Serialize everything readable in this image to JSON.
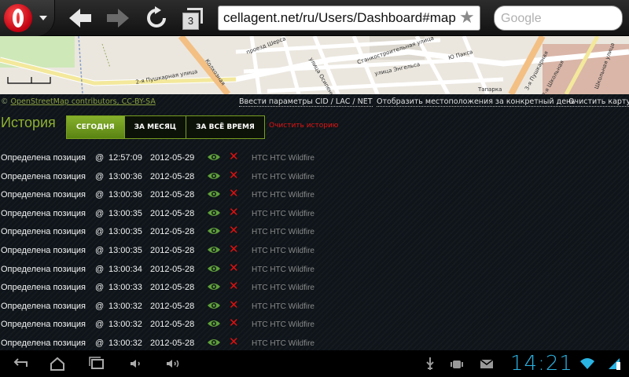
{
  "browser": {
    "tabs_count": "3",
    "url": "cellagent.net/ru/Users/Dashboard#map",
    "search_placeholder": "Google"
  },
  "map": {
    "street_labels": [
      "2-я Пушкарная улица",
      "Колхозная",
      "проезд Шерса",
      "Станкостроительная улица",
      "улица Энгельса",
      "Тапарка",
      "Ю Пакса",
      "улица Осипенко",
      "3-я Пушкарная",
      "Школьная улица",
      "2-я Школьная"
    ]
  },
  "links": {
    "attribution_prefix": "©",
    "attribution_link": "OpenStreetMap contributors, CC-BY-SA",
    "enter_params": "Ввести параметры CID / LAC / NET",
    "show_location": "Отобразить местоположения за конкретный день",
    "clear_map": "Очистить карту"
  },
  "history": {
    "title": "История",
    "tabs": [
      {
        "label": "СЕГОДНЯ",
        "active": true
      },
      {
        "label": "ЗА МЕСЯЦ",
        "active": false
      },
      {
        "label": "ЗА ВСЁ ВРЕМЯ",
        "active": false
      }
    ],
    "clear_label": "Очистить историю",
    "rows": [
      {
        "text": "Определена позиция",
        "at": "@",
        "time": "12:57:09",
        "date": "2012-05-29",
        "device": "HTC HTC Wildfire"
      },
      {
        "text": "Определена позиция",
        "at": "@",
        "time": "13:00:36",
        "date": "2012-05-28",
        "device": "HTC HTC Wildfire"
      },
      {
        "text": "Определена позиция",
        "at": "@",
        "time": "13:00:36",
        "date": "2012-05-28",
        "device": "HTC HTC Wildfire"
      },
      {
        "text": "Определена позиция",
        "at": "@",
        "time": "13:00:35",
        "date": "2012-05-28",
        "device": "HTC HTC Wildfire"
      },
      {
        "text": "Определена позиция",
        "at": "@",
        "time": "13:00:35",
        "date": "2012-05-28",
        "device": "HTC HTC Wildfire"
      },
      {
        "text": "Определена позиция",
        "at": "@",
        "time": "13:00:35",
        "date": "2012-05-28",
        "device": "HTC HTC Wildfire"
      },
      {
        "text": "Определена позиция",
        "at": "@",
        "time": "13:00:34",
        "date": "2012-05-28",
        "device": "HTC HTC Wildfire"
      },
      {
        "text": "Определена позиция",
        "at": "@",
        "time": "13:00:33",
        "date": "2012-05-28",
        "device": "HTC HTC Wildfire"
      },
      {
        "text": "Определена позиция",
        "at": "@",
        "time": "13:00:32",
        "date": "2012-05-28",
        "device": "HTC HTC Wildfire"
      },
      {
        "text": "Определена позиция",
        "at": "@",
        "time": "13:00:32",
        "date": "2012-05-28",
        "device": "HTC HTC Wildfire"
      },
      {
        "text": "Определена позиция",
        "at": "@",
        "time": "13:00:32",
        "date": "2012-05-28",
        "device": "HTC HTC Wildfire"
      }
    ]
  },
  "statusbar": {
    "clock": "14:21"
  },
  "colors": {
    "accent_green": "#8fb030",
    "delete_red": "#e01010",
    "clock_blue": "#2ab4e4"
  },
  "icons": {
    "row_view": "eye-icon",
    "row_delete": "close-icon"
  }
}
